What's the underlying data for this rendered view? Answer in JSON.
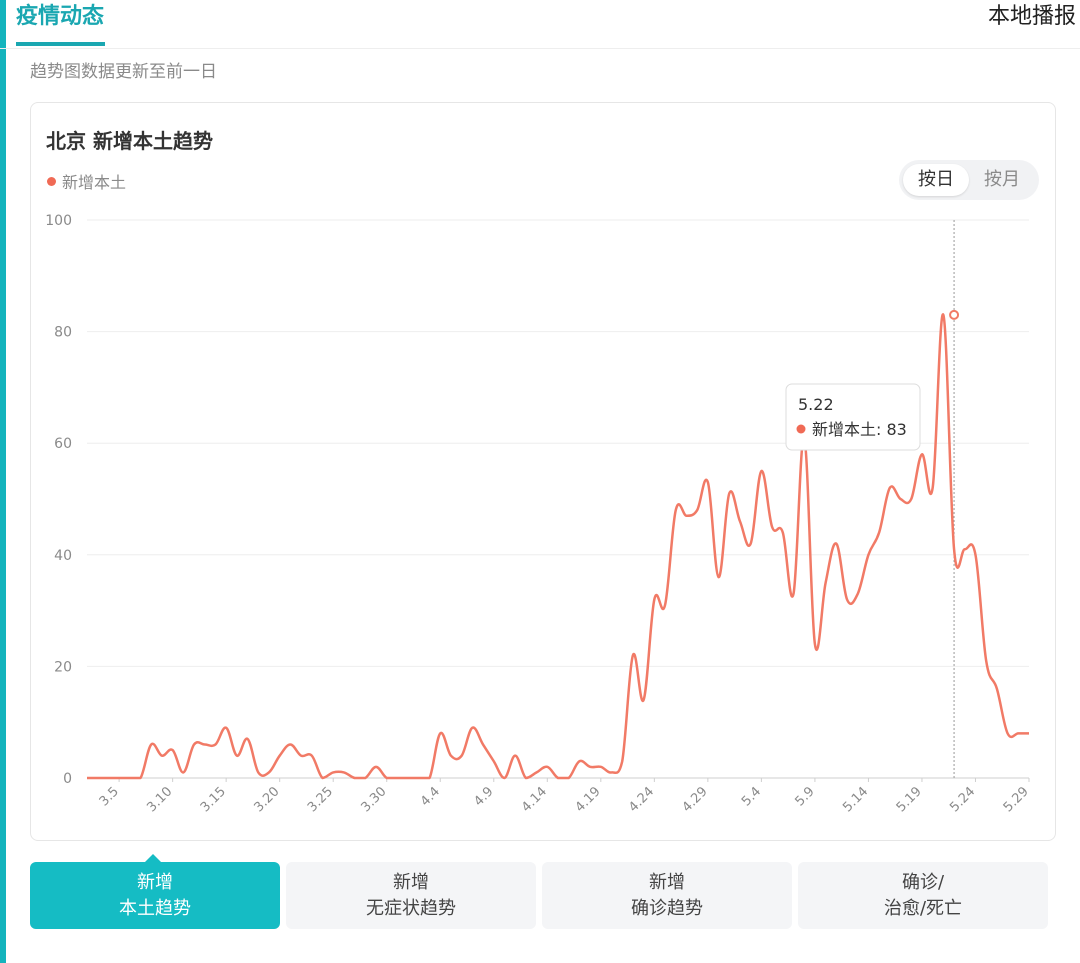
{
  "header": {
    "active_tab": "疫情动态",
    "right_link": "本地播报"
  },
  "update_note": "趋势图数据更新至前一日",
  "toggle": {
    "day_label": "按日",
    "month_label": "按月",
    "selected": "按日"
  },
  "bottom_tabs": [
    {
      "line1": "新增",
      "line2": "本土趋势",
      "active": true
    },
    {
      "line1": "新增",
      "line2": "无症状趋势",
      "active": false
    },
    {
      "line1": "新增",
      "line2": "确诊趋势",
      "active": false
    },
    {
      "line1": "确诊/",
      "line2": "治愈/死亡",
      "active": false
    }
  ],
  "colors": {
    "accent": "#1aa7b1",
    "active_tab_bg": "#15bcc4",
    "series": "#f17a66",
    "legend_dot": "#f06a55"
  },
  "chart_data": {
    "type": "line",
    "title": "北京 新增本土趋势",
    "xlabel": "",
    "ylabel": "",
    "ylim": [
      0,
      100
    ],
    "yticks": [
      0,
      20,
      40,
      60,
      80,
      100
    ],
    "grid": true,
    "legend_position": "top-left",
    "tick_labels": [
      "3.5",
      "3.10",
      "3.15",
      "3.20",
      "3.25",
      "3.30",
      "4.4",
      "4.9",
      "4.14",
      "4.19",
      "4.24",
      "4.29",
      "5.4",
      "5.9",
      "5.14",
      "5.19",
      "5.24",
      "5.29"
    ],
    "x": [
      "3.2",
      "3.3",
      "3.4",
      "3.5",
      "3.6",
      "3.7",
      "3.8",
      "3.9",
      "3.10",
      "3.11",
      "3.12",
      "3.13",
      "3.14",
      "3.15",
      "3.16",
      "3.17",
      "3.18",
      "3.19",
      "3.20",
      "3.21",
      "3.22",
      "3.23",
      "3.24",
      "3.25",
      "3.26",
      "3.27",
      "3.28",
      "3.29",
      "3.30",
      "3.31",
      "4.1",
      "4.2",
      "4.3",
      "4.4",
      "4.5",
      "4.6",
      "4.7",
      "4.8",
      "4.9",
      "4.10",
      "4.11",
      "4.12",
      "4.13",
      "4.14",
      "4.15",
      "4.16",
      "4.17",
      "4.18",
      "4.19",
      "4.20",
      "4.21",
      "4.22",
      "4.23",
      "4.24",
      "4.25",
      "4.26",
      "4.27",
      "4.28",
      "4.29",
      "4.30",
      "5.1",
      "5.2",
      "5.3",
      "5.4",
      "5.5",
      "5.6",
      "5.7",
      "5.8",
      "5.9",
      "5.10",
      "5.11",
      "5.12",
      "5.13",
      "5.14",
      "5.15",
      "5.16",
      "5.17",
      "5.18",
      "5.19",
      "5.20",
      "5.21",
      "5.22",
      "5.23",
      "5.24",
      "5.25",
      "5.26",
      "5.27",
      "5.28",
      "5.29"
    ],
    "series": [
      {
        "name": "新增本土",
        "color": "#f17a66",
        "values": [
          0,
          0,
          0,
          0,
          0,
          0,
          6,
          4,
          5,
          1,
          6,
          6,
          6,
          9,
          4,
          7,
          1,
          1,
          4,
          6,
          4,
          4,
          0,
          1,
          1,
          0,
          0,
          2,
          0,
          0,
          0,
          0,
          0,
          8,
          4,
          4,
          9,
          6,
          3,
          0,
          4,
          0,
          1,
          2,
          0,
          0,
          3,
          2,
          2,
          1,
          3,
          22,
          14,
          32,
          31,
          48,
          47,
          48,
          53,
          36,
          51,
          46,
          42,
          55,
          45,
          44,
          33,
          61,
          24,
          35,
          42,
          32,
          33,
          40,
          44,
          52,
          50,
          50,
          58,
          52,
          83,
          41,
          41,
          40,
          21,
          16,
          8,
          8,
          8
        ]
      }
    ],
    "tooltip": {
      "date": "5.22",
      "series_name": "新增本土",
      "value_text": "新增本土: 83",
      "value": 83
    }
  }
}
